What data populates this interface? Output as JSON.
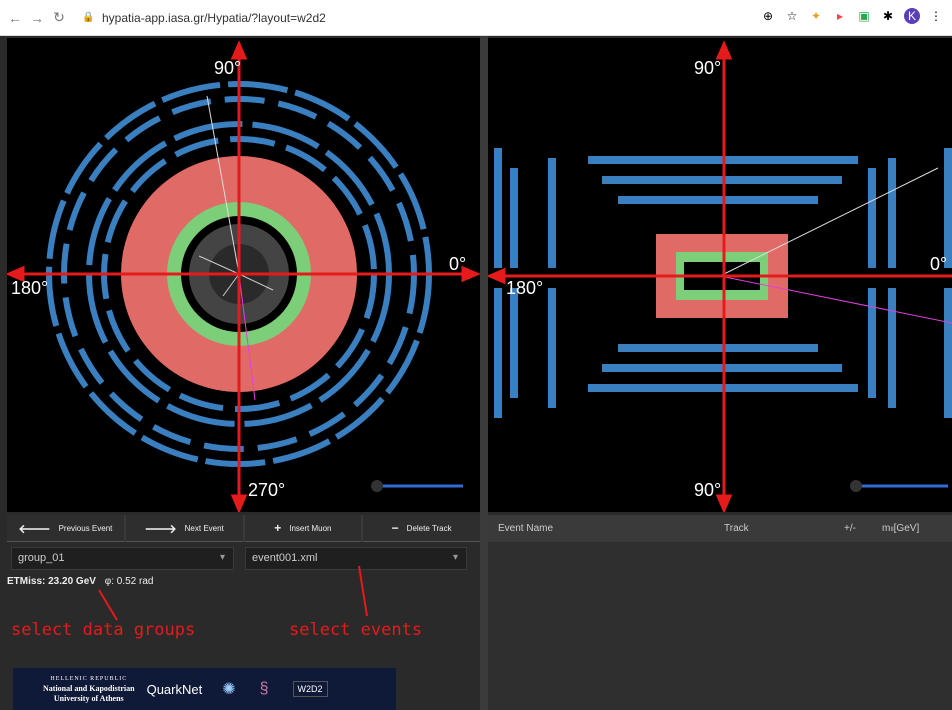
{
  "browser": {
    "url": "hypatia-app.iasa.gr/Hypatia/?layout=w2d2",
    "avatar_letter": "K"
  },
  "view_left": {
    "label_top": "90°",
    "label_bottom": "270°",
    "label_left": "180°",
    "label_right": "0°"
  },
  "view_right": {
    "label_top": "90°",
    "label_bottom": "90°",
    "label_left": "180°",
    "label_right": "0°"
  },
  "toolbar": {
    "prev": "Previous Event",
    "next": "Next Event",
    "insert": "Insert Muon",
    "delete": "Delete Track"
  },
  "panel": {
    "group_select": "group_01",
    "event_select": "event001.xml",
    "etmiss_label": "ETMiss: 23.20 GeV",
    "phi_value": "φ: 0.52 rad",
    "annotation_groups": "select data groups",
    "annotation_events": "select events"
  },
  "logos": {
    "hellenic_small": "HELLENIC REPUBLIC",
    "hellenic_main1": "National and Kapodistrian",
    "hellenic_main2": "University of Athens",
    "quarknet": "QuarkNet",
    "w2d2": "W2D2"
  },
  "table": {
    "col_event": "Event Name",
    "col_track": "Track",
    "col_pm": "+/-",
    "col_mass": "mₗₗ[GeV]"
  },
  "colors": {
    "accent_red": "#e51b1b",
    "calorimeter_red": "#e06a66",
    "tracker_green": "#7ccf78",
    "muon_blue": "#3a7fc0"
  }
}
